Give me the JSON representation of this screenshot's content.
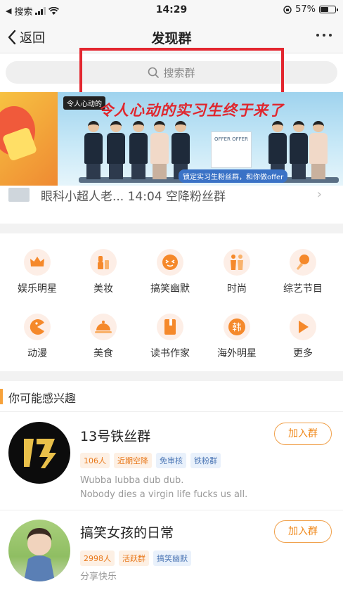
{
  "status_bar": {
    "carrier": "搜索",
    "time": "14:29",
    "battery": "57%"
  },
  "nav": {
    "back_label": "返回",
    "title": "发现群"
  },
  "search": {
    "placeholder": "搜索群"
  },
  "banner": {
    "tag": "令人心动的",
    "headline": "令人心动的实习生终于来了",
    "offer_text": "OFFER\nOFFER",
    "sub": "锁定实习生粉丝群，和你做offer"
  },
  "notice": {
    "text": "眼科小超人老... 14:04 空降粉丝群"
  },
  "categories": [
    {
      "label": "娱乐明星",
      "icon": "crown-icon"
    },
    {
      "label": "美妆",
      "icon": "lipstick-icon"
    },
    {
      "label": "搞笑幽默",
      "icon": "laugh-face-icon"
    },
    {
      "label": "时尚",
      "icon": "fashion-icon"
    },
    {
      "label": "综艺节目",
      "icon": "microphone-icon"
    },
    {
      "label": "动漫",
      "icon": "pacman-icon"
    },
    {
      "label": "美食",
      "icon": "food-cloche-icon"
    },
    {
      "label": "读书作家",
      "icon": "book-icon"
    },
    {
      "label": "海外明星",
      "icon": "korean-char-icon"
    },
    {
      "label": "更多",
      "icon": "play-more-icon"
    }
  ],
  "section": {
    "title": "你可能感兴趣"
  },
  "groups": [
    {
      "name": "13号铁丝群",
      "tags": [
        "106人",
        "近期空降",
        "免审核",
        "铁粉群"
      ],
      "desc": [
        "Wubba lubba dub dub.",
        "Nobody dies a virgin life fucks us all."
      ],
      "join_label": "加入群",
      "avatar_text": "13"
    },
    {
      "name": "搞笑女孩的日常",
      "tags": [
        "2998人",
        "活跃群",
        "搞笑幽默"
      ],
      "desc": [
        "分享快乐"
      ],
      "join_label": "加入群"
    }
  ],
  "colors": {
    "accent": "#f08a1d",
    "highlight_box": "#e3262f",
    "tag_orange": "#e8781a",
    "tag_blue": "#4e78b6"
  }
}
